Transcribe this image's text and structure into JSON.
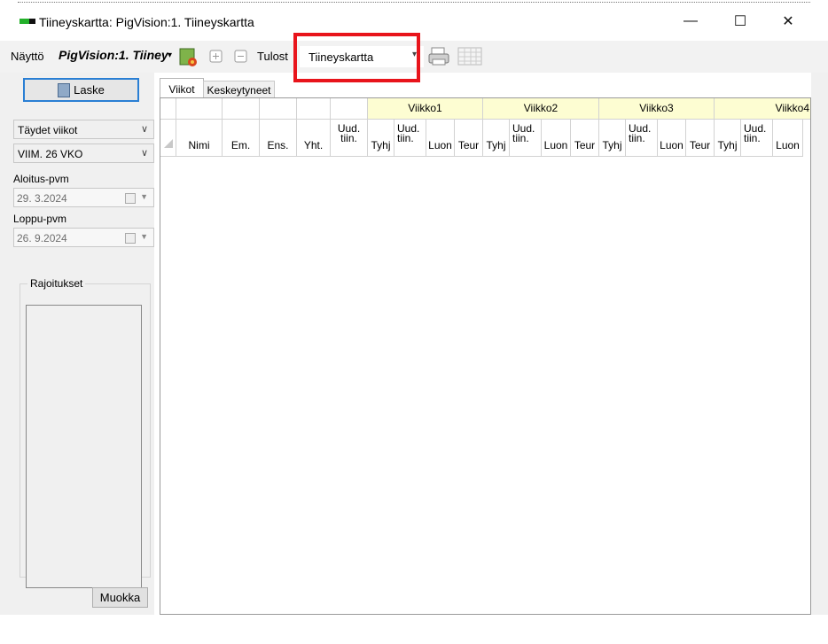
{
  "window": {
    "title": "Tiineyskartta: PigVision:1. Tiineyskartta",
    "controls": [
      "—",
      "☐",
      "✕"
    ]
  },
  "toolbar": {
    "nayto_label": "Näyttö",
    "view_name": "PigVision:1. Tiiney",
    "view_arrow": "▾",
    "tulos_label": "Tulost",
    "report_value": "Tiineyskartta",
    "report_arrow": "▾"
  },
  "left": {
    "laske_label": "Laske",
    "period_select": "Täydet viikot",
    "range_select": "VIIM. 26 VKO",
    "start_label": "Aloitus-pvm",
    "start_value": "29.  3.2024",
    "end_label": "Loppu-pvm",
    "end_value": "26.  9.2024",
    "restrictions_label": "Rajoitukset",
    "muokka_label": "Muokka"
  },
  "tabs": [
    {
      "label": "Viikot"
    },
    {
      "label": "Keskeytyneet"
    }
  ],
  "grid": {
    "columns": [
      "Nimi",
      "Em.",
      "Ens.",
      "Yht."
    ],
    "uud_tiin": "Uud.\ntiin.",
    "week_sub": [
      "Tyhj",
      "Uud.\ntiin.",
      "Luon",
      "Teur"
    ],
    "weeks": [
      "Viikko1",
      "Viikko2",
      "Viikko3",
      "Viikko4"
    ]
  },
  "colors": {
    "accent": "#2a7fd4",
    "highlight": "#e8141b",
    "week_header": "#fdfdd2"
  }
}
